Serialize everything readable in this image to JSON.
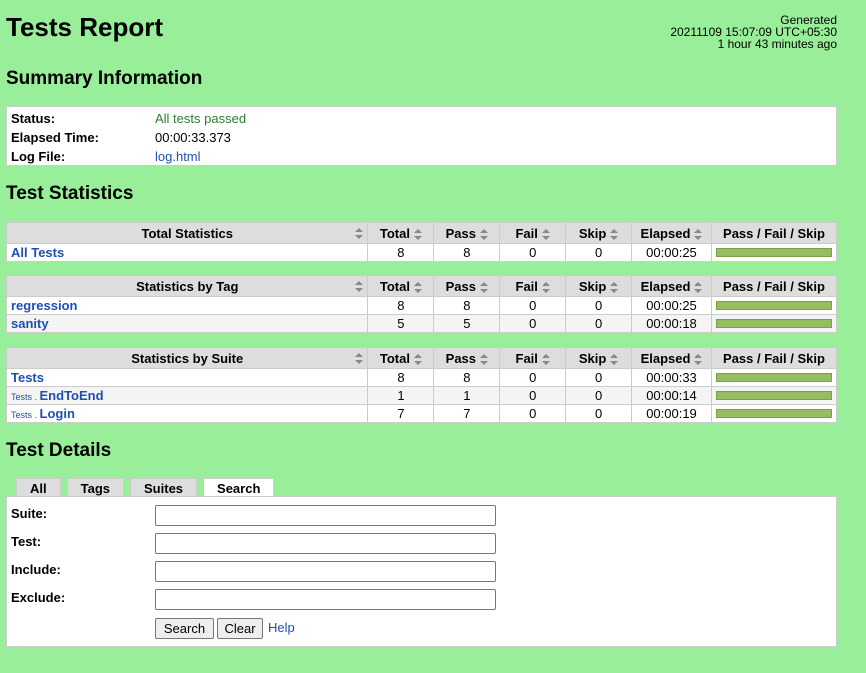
{
  "header": {
    "title": "Tests Report",
    "generated_label": "Generated",
    "generated_time": "20211109 15:07:09 UTC+05:30",
    "generated_ago": "1 hour 43 minutes ago"
  },
  "summary": {
    "heading": "Summary Information",
    "status_label": "Status:",
    "status_value": "All tests passed",
    "elapsed_label": "Elapsed Time:",
    "elapsed_value": "00:00:33.373",
    "logfile_label": "Log File:",
    "logfile_value": "log.html"
  },
  "statistics": {
    "heading": "Test Statistics",
    "columns": [
      "Total",
      "Pass",
      "Fail",
      "Skip",
      "Elapsed",
      "Pass / Fail / Skip"
    ],
    "total": {
      "title": "Total Statistics",
      "rows": [
        {
          "name": "All Tests",
          "total": "8",
          "pass": "8",
          "fail": "0",
          "skip": "0",
          "elapsed": "00:00:25"
        }
      ]
    },
    "tag": {
      "title": "Statistics by Tag",
      "rows": [
        {
          "name": "regression",
          "total": "8",
          "pass": "8",
          "fail": "0",
          "skip": "0",
          "elapsed": "00:00:25"
        },
        {
          "name": "sanity",
          "total": "5",
          "pass": "5",
          "fail": "0",
          "skip": "0",
          "elapsed": "00:00:18"
        }
      ]
    },
    "suite": {
      "title": "Statistics by Suite",
      "rows": [
        {
          "parent": "",
          "name": "Tests",
          "total": "8",
          "pass": "8",
          "fail": "0",
          "skip": "0",
          "elapsed": "00:00:33"
        },
        {
          "parent": "Tests . ",
          "name": "EndToEnd",
          "total": "1",
          "pass": "1",
          "fail": "0",
          "skip": "0",
          "elapsed": "00:00:14"
        },
        {
          "parent": "Tests . ",
          "name": "Login",
          "total": "7",
          "pass": "7",
          "fail": "0",
          "skip": "0",
          "elapsed": "00:00:19"
        }
      ]
    }
  },
  "details": {
    "heading": "Test Details",
    "tabs": [
      "All",
      "Tags",
      "Suites",
      "Search"
    ],
    "active_tab": "Search",
    "fields": {
      "suite": "Suite:",
      "test": "Test:",
      "include": "Include:",
      "exclude": "Exclude:"
    },
    "search_button": "Search",
    "clear_button": "Clear",
    "help_link": "Help"
  },
  "colors": {
    "background": "#99ee99",
    "pass_bar": "#97bd61",
    "link": "#1f4fb4"
  }
}
